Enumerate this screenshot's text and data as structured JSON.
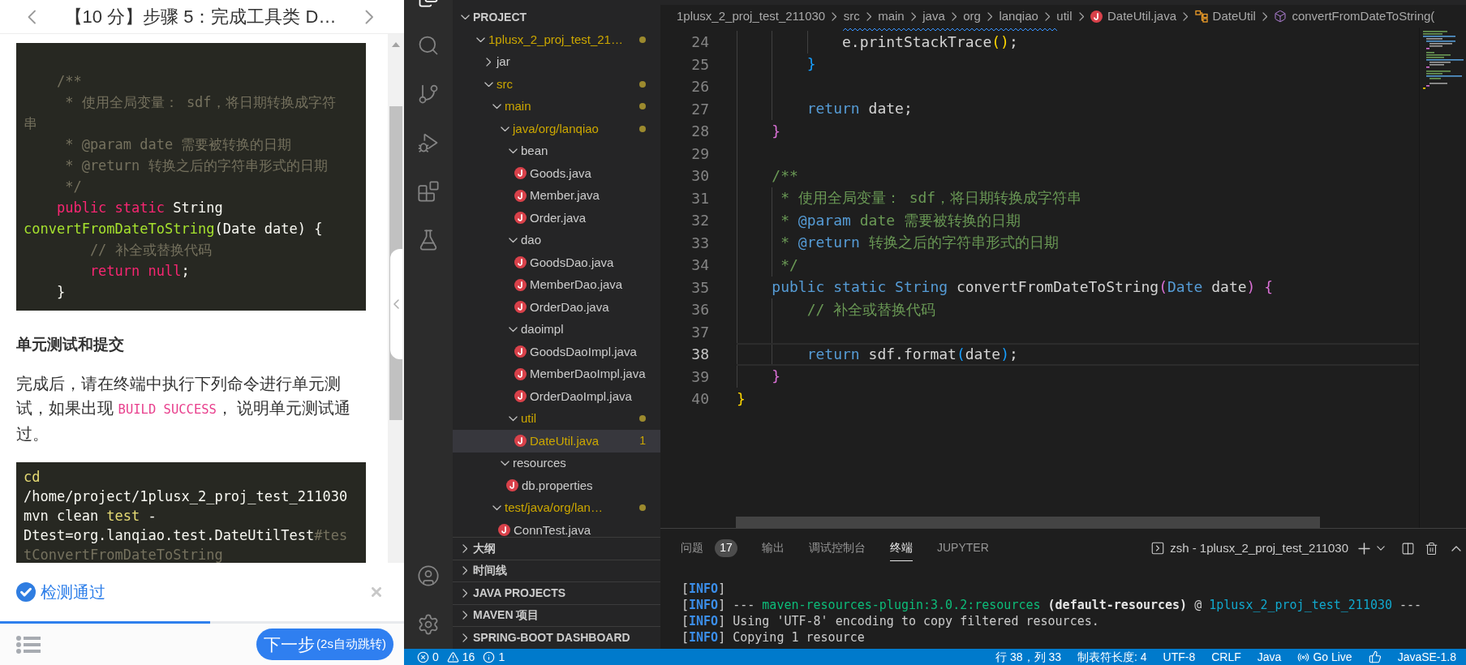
{
  "lesson": {
    "title": "【10 分】步骤 5：完成工具类 D…",
    "code_block_1": {
      "lines": [
        {
          "tokens": [
            {
              "text": "    /**",
              "kind": "comment"
            }
          ]
        },
        {
          "tokens": [
            {
              "text": "     * 使用全局变量： sdf，将日期转换成字符",
              "kind": "comment"
            }
          ]
        },
        {
          "tokens": [
            {
              "text": "串",
              "kind": "comment"
            }
          ]
        },
        {
          "tokens": [
            {
              "text": "     * @param date 需要被转换的日期",
              "kind": "comment"
            }
          ]
        },
        {
          "tokens": [
            {
              "text": "     * @return 转换之后的字符串形式的日期",
              "kind": "comment"
            }
          ]
        },
        {
          "tokens": [
            {
              "text": "     */",
              "kind": "comment"
            }
          ]
        },
        {
          "tokens": [
            {
              "text": "    public static",
              "kind": "keyword"
            },
            {
              "text": " String",
              "kind": "plain"
            }
          ]
        },
        {
          "tokens": [
            {
              "text": "convertFromDateToString",
              "kind": "function"
            },
            {
              "text": "(Date date) {",
              "kind": "plain"
            }
          ]
        },
        {
          "tokens": [
            {
              "text": "        // 补全或替换代码",
              "kind": "comment"
            }
          ]
        },
        {
          "tokens": [
            {
              "text": "        return null",
              "kind": "keyword"
            },
            {
              "text": ";",
              "kind": "plain"
            }
          ]
        },
        {
          "tokens": [
            {
              "text": "    }",
              "kind": "plain"
            }
          ]
        }
      ]
    },
    "section_heading": "单元测试和提交",
    "paragraph": [
      {
        "text": "完成后，请在终端中执行下列命令进行单元测试，如果出现 ",
        "kind": "text"
      },
      {
        "text": "BUILD SUCCESS",
        "kind": "code"
      },
      {
        "text": "， 说明单元测试通过。",
        "kind": "text"
      }
    ],
    "code_block_2": {
      "lines": [
        {
          "tokens": [
            {
              "text": "cd",
              "kind": "command"
            }
          ]
        },
        {
          "tokens": [
            {
              "text": "/home/project/1plusx_2_proj_test_211030",
              "kind": "plain"
            }
          ]
        },
        {
          "tokens": [
            {
              "text": "mvn clean ",
              "kind": "plain"
            },
            {
              "text": "test",
              "kind": "command"
            },
            {
              "text": " -",
              "kind": "plain"
            }
          ]
        },
        {
          "tokens": [
            {
              "text": "Dtest=org.lanqiao.test.DateUtilTest",
              "kind": "plain"
            },
            {
              "text": "#tes",
              "kind": "comment"
            }
          ]
        },
        {
          "tokens": [
            {
              "text": "tConvertFromDateToString",
              "kind": "comment"
            }
          ]
        }
      ]
    },
    "result": {
      "message": "检测通过",
      "passed": true
    },
    "progress": {
      "level": 0.52
    },
    "next_button": {
      "label": "下一步",
      "hint": "(2s自动跳转)"
    }
  },
  "activity_bar": {
    "items": [
      {
        "kind": "explorer",
        "selected": true
      },
      {
        "kind": "search",
        "selected": false
      },
      {
        "kind": "source-control",
        "selected": false
      },
      {
        "kind": "run-debug",
        "selected": false
      },
      {
        "kind": "extensions",
        "selected": false
      },
      {
        "kind": "testing",
        "selected": false
      }
    ],
    "bottom_items": [
      {
        "kind": "accounts"
      },
      {
        "kind": "settings"
      }
    ]
  },
  "sidebar": {
    "header": {
      "label": "PROJECT",
      "expanded": true
    },
    "tree": [
      {
        "label": "1plusx_2_proj_test_21…",
        "kind": "folder",
        "expanded": true,
        "warning": true,
        "selected": false,
        "children": [
          {
            "label": "jar",
            "kind": "folder",
            "expanded": false,
            "warning": false,
            "selected": false
          },
          {
            "label": "src",
            "kind": "folder",
            "expanded": true,
            "warning": true,
            "selected": false,
            "children": [
              {
                "label": "main",
                "kind": "folder",
                "expanded": true,
                "warning": true,
                "selected": false,
                "children": [
                  {
                    "label": "java/org/lanqiao",
                    "kind": "folder",
                    "expanded": true,
                    "warning": true,
                    "selected": false,
                    "children": [
                      {
                        "label": "bean",
                        "kind": "folder",
                        "expanded": true,
                        "warning": false,
                        "selected": false,
                        "children": [
                          {
                            "label": "Goods.java",
                            "kind": "file",
                            "warning": false,
                            "selected": false
                          },
                          {
                            "label": "Member.java",
                            "kind": "file",
                            "warning": false,
                            "selected": false
                          },
                          {
                            "label": "Order.java",
                            "kind": "file",
                            "warning": false,
                            "selected": false
                          }
                        ]
                      },
                      {
                        "label": "dao",
                        "kind": "folder",
                        "expanded": true,
                        "warning": false,
                        "selected": false,
                        "children": [
                          {
                            "label": "GoodsDao.java",
                            "kind": "file",
                            "warning": false,
                            "selected": false
                          },
                          {
                            "label": "MemberDao.java",
                            "kind": "file",
                            "warning": false,
                            "selected": false
                          },
                          {
                            "label": "OrderDao.java",
                            "kind": "file",
                            "warning": false,
                            "selected": false
                          }
                        ]
                      },
                      {
                        "label": "daoimpl",
                        "kind": "folder",
                        "expanded": true,
                        "warning": false,
                        "selected": false,
                        "children": [
                          {
                            "label": "GoodsDaoImpl.java",
                            "kind": "file",
                            "warning": false,
                            "selected": false
                          },
                          {
                            "label": "MemberDaoImpl.java",
                            "kind": "file",
                            "warning": false,
                            "selected": false
                          },
                          {
                            "label": "OrderDaoImpl.java",
                            "kind": "file",
                            "warning": false,
                            "selected": false
                          }
                        ]
                      },
                      {
                        "label": "util",
                        "kind": "folder",
                        "expanded": true,
                        "warning": true,
                        "selected": false,
                        "children": [
                          {
                            "label": "DateUtil.java",
                            "kind": "file",
                            "warning": true,
                            "selected": true,
                            "badge": "1"
                          }
                        ]
                      }
                    ]
                  },
                  {
                    "label": "resources",
                    "kind": "folder",
                    "expanded": true,
                    "warning": false,
                    "selected": false,
                    "children": [
                      {
                        "label": "db.properties",
                        "kind": "file",
                        "warning": false,
                        "selected": false
                      }
                    ]
                  }
                ]
              },
              {
                "label": "test/java/org/lan…",
                "kind": "folder",
                "expanded": true,
                "warning": true,
                "selected": false,
                "children": [
                  {
                    "label": "ConnTest.java",
                    "kind": "file",
                    "warning": false,
                    "selected": false
                  }
                ]
              }
            ]
          }
        ]
      }
    ],
    "sections": [
      {
        "label": "大纲",
        "expanded": false
      },
      {
        "label": "时间线",
        "expanded": false
      },
      {
        "label": "JAVA PROJECTS",
        "expanded": false
      },
      {
        "label": "MAVEN 项目",
        "expanded": false
      },
      {
        "label": "SPRING-BOOT DASHBOARD",
        "expanded": false
      }
    ]
  },
  "editor": {
    "breadcrumb": [
      {
        "text": "1plusx_2_proj_test_211030",
        "kind": "folder"
      },
      {
        "text": "src",
        "kind": "folder"
      },
      {
        "text": "main",
        "kind": "folder"
      },
      {
        "text": "java",
        "kind": "folder"
      },
      {
        "text": "org",
        "kind": "folder"
      },
      {
        "text": "lanqiao",
        "kind": "folder"
      },
      {
        "text": "util",
        "kind": "folder"
      },
      {
        "text": "DateUtil.java",
        "kind": "file"
      },
      {
        "text": "DateUtil",
        "kind": "class"
      },
      {
        "text": "convertFromDateToString(",
        "kind": "method"
      }
    ],
    "lines": [
      {
        "number": "24",
        "current": false,
        "tokens": [
          {
            "text": "            e.printStackTrace",
            "kind": "plain"
          },
          {
            "text": "()",
            "kind": "bracket1"
          },
          {
            "text": ";",
            "kind": "plain"
          }
        ]
      },
      {
        "number": "25",
        "current": false,
        "tokens": [
          {
            "text": "        }",
            "kind": "bracket3"
          }
        ]
      },
      {
        "number": "26",
        "current": false
      },
      {
        "number": "27",
        "current": false,
        "tokens": [
          {
            "text": "        return",
            "kind": "keyword"
          },
          {
            "text": " date;",
            "kind": "plain"
          }
        ]
      },
      {
        "number": "28",
        "current": false,
        "tokens": [
          {
            "text": "    }",
            "kind": "bracket2"
          }
        ]
      },
      {
        "number": "29",
        "current": false
      },
      {
        "number": "30",
        "current": false,
        "tokens": [
          {
            "text": "    /**",
            "kind": "comment"
          }
        ]
      },
      {
        "number": "31",
        "current": false,
        "tokens": [
          {
            "text": "     * 使用全局变量： sdf，将日期转换成字符串",
            "kind": "comment"
          }
        ]
      },
      {
        "number": "32",
        "current": false,
        "tokens": [
          {
            "text": "     * ",
            "kind": "comment"
          },
          {
            "text": "@param",
            "kind": "doctag"
          },
          {
            "text": " date 需要被转换的日期",
            "kind": "comment"
          }
        ]
      },
      {
        "number": "33",
        "current": false,
        "tokens": [
          {
            "text": "     * ",
            "kind": "comment"
          },
          {
            "text": "@return",
            "kind": "doctag"
          },
          {
            "text": " 转换之后的字符串形式的日期",
            "kind": "comment"
          }
        ]
      },
      {
        "number": "34",
        "current": false,
        "tokens": [
          {
            "text": "     */",
            "kind": "comment"
          }
        ]
      },
      {
        "number": "35",
        "current": false,
        "tokens": [
          {
            "text": "    public static String",
            "kind": "keyword"
          },
          {
            "text": " convertFromDateToString",
            "kind": "plain"
          },
          {
            "text": "(",
            "kind": "bracket2"
          },
          {
            "text": "Date",
            "kind": "keyword"
          },
          {
            "text": " date",
            "kind": "plain"
          },
          {
            "text": ")",
            "kind": "bracket2"
          },
          {
            "text": " {",
            "kind": "bracket2"
          }
        ]
      },
      {
        "number": "36",
        "current": false,
        "tokens": [
          {
            "text": "        // 补全或替换代码",
            "kind": "comment"
          }
        ]
      },
      {
        "number": "37",
        "current": false
      },
      {
        "number": "38",
        "current": true,
        "tokens": [
          {
            "text": "        return",
            "kind": "keyword"
          },
          {
            "text": " sdf.format",
            "kind": "plain"
          },
          {
            "text": "(",
            "kind": "bracket3"
          },
          {
            "text": "date",
            "kind": "plain"
          },
          {
            "text": ")",
            "kind": "bracket3"
          },
          {
            "text": ";",
            "kind": "plain"
          }
        ]
      },
      {
        "number": "39",
        "current": false,
        "tokens": [
          {
            "text": "    }",
            "kind": "bracket2"
          }
        ]
      },
      {
        "number": "40",
        "current": false,
        "tokens": [
          {
            "text": "}",
            "kind": "bracket1"
          }
        ]
      }
    ]
  },
  "panel": {
    "tabs": [
      {
        "label": "问题",
        "badge": "17",
        "selected": false
      },
      {
        "label": "输出",
        "selected": false
      },
      {
        "label": "调试控制台",
        "selected": false
      },
      {
        "label": "终端",
        "selected": true
      },
      {
        "label": "JUPYTER",
        "selected": false
      }
    ],
    "terminal_title": "zsh - 1plusx_2_proj_test_211030",
    "terminal_lines": [
      {
        "tokens": [
          {
            "text": "[",
            "kind": "plain"
          },
          {
            "text": "INFO",
            "kind": "info"
          },
          {
            "text": "]",
            "kind": "plain"
          }
        ]
      },
      {
        "tokens": [
          {
            "text": "[",
            "kind": "plain"
          },
          {
            "text": "INFO",
            "kind": "info"
          },
          {
            "text": "] --- ",
            "kind": "plain"
          },
          {
            "text": "maven-resources-plugin:3.0.2:resources",
            "kind": "success"
          },
          {
            "text": " (default-resources)",
            "kind": "bold"
          },
          {
            "text": " @ ",
            "kind": "plain"
          },
          {
            "text": "1plusx_2_proj_test_211030",
            "kind": "link"
          },
          {
            "text": " ---",
            "kind": "plain"
          }
        ]
      },
      {
        "tokens": [
          {
            "text": "[",
            "kind": "plain"
          },
          {
            "text": "INFO",
            "kind": "info"
          },
          {
            "text": "] Using 'UTF-8' encoding to copy filtered resources.",
            "kind": "plain"
          }
        ]
      },
      {
        "tokens": [
          {
            "text": "[",
            "kind": "plain"
          },
          {
            "text": "INFO",
            "kind": "info"
          },
          {
            "text": "] Copying 1 resource",
            "kind": "plain"
          }
        ]
      }
    ]
  },
  "status_bar": {
    "problems": [
      {
        "kind": "error",
        "count": "0"
      },
      {
        "kind": "warning",
        "count": "16"
      },
      {
        "kind": "info",
        "count": "1"
      }
    ],
    "items": [
      {
        "kind": "text",
        "text": "行 38，列 33"
      },
      {
        "kind": "text",
        "text": "制表符长度: 4"
      },
      {
        "kind": "text",
        "text": "UTF-8"
      },
      {
        "kind": "text",
        "text": "CRLF"
      },
      {
        "kind": "text",
        "text": "Java"
      },
      {
        "kind": "live",
        "text": "Go Live"
      },
      {
        "kind": "feedback"
      },
      {
        "kind": "text",
        "text": "JavaSE-1.8"
      }
    ]
  }
}
